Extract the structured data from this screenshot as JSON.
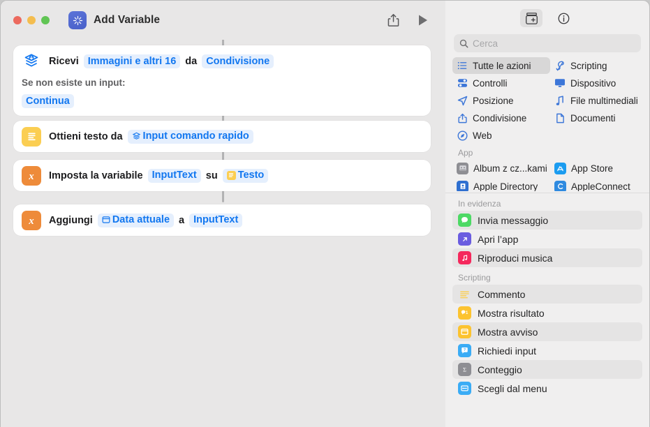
{
  "window": {
    "title": "Add Variable",
    "app_icon": "shortcuts-icon",
    "traffic_lights": [
      "close",
      "minimize",
      "zoom"
    ],
    "share_icon": "share-icon",
    "run_icon": "play-icon"
  },
  "workflow": {
    "actions": [
      {
        "icon": "receive-input-icon",
        "icon_style": "plain-blue",
        "parts": [
          {
            "type": "text",
            "value": "Ricevi"
          },
          {
            "type": "token",
            "value": "Immagini e altri 16"
          },
          {
            "type": "text",
            "value": "da"
          },
          {
            "type": "token",
            "value": "Condivisione"
          }
        ],
        "sub_label": "Se non esiste un input:",
        "sub_token": "Continua"
      },
      {
        "icon": "text-document-icon",
        "icon_style": "yellow",
        "parts": [
          {
            "type": "text",
            "value": "Ottieni testo da"
          },
          {
            "type": "token",
            "value": "Input comando rapido",
            "token_icon": "shortcut-input-icon"
          }
        ]
      },
      {
        "icon": "variable-x-icon",
        "icon_style": "orange",
        "parts": [
          {
            "type": "text",
            "value": "Imposta la variabile"
          },
          {
            "type": "token",
            "value": "InputText"
          },
          {
            "type": "text",
            "value": "su"
          },
          {
            "type": "token",
            "value": "Testo",
            "token_icon": "text-document-icon"
          }
        ]
      },
      {
        "icon": "variable-x-icon",
        "icon_style": "orange",
        "parts": [
          {
            "type": "text",
            "value": "Aggiungi"
          },
          {
            "type": "token",
            "value": "Data attuale",
            "token_icon": "date-icon"
          },
          {
            "type": "text",
            "value": "a"
          },
          {
            "type": "token",
            "value": "InputText"
          }
        ]
      }
    ]
  },
  "library": {
    "toolbar": [
      {
        "name": "action-library-button",
        "icon": "add-action-icon",
        "active": true
      },
      {
        "name": "info-button",
        "icon": "info-circle-icon",
        "active": false
      }
    ],
    "search": {
      "placeholder": "Cerca",
      "value": "",
      "icon": "search-icon"
    },
    "categories": [
      {
        "label": "Tutte le azioni",
        "icon": "list-icon",
        "selected": true
      },
      {
        "label": "Scripting",
        "icon": "scripting-icon",
        "selected": false
      },
      {
        "label": "Controlli",
        "icon": "controls-icon",
        "selected": false
      },
      {
        "label": "Dispositivo",
        "icon": "display-icon",
        "selected": false
      },
      {
        "label": "Posizione",
        "icon": "location-arrow-icon",
        "selected": false
      },
      {
        "label": "File multimediali",
        "icon": "music-note-icon",
        "selected": false
      },
      {
        "label": "Condivisione",
        "icon": "share-icon",
        "selected": false
      },
      {
        "label": "Documenti",
        "icon": "document-icon",
        "selected": false
      },
      {
        "label": "Web",
        "icon": "compass-icon",
        "selected": false
      }
    ],
    "app_section": {
      "title": "App",
      "items": [
        {
          "label": "Album z cz...kami",
          "icon": "photos-album-icon"
        },
        {
          "label": "App Store",
          "icon": "app-store-icon"
        },
        {
          "label": "Apple Directory",
          "icon": "apple-directory-icon"
        },
        {
          "label": "AppleConnect",
          "icon": "appleconnect-icon"
        }
      ]
    },
    "featured_section": {
      "title": "In evidenza",
      "items": [
        {
          "label": "Invia messaggio",
          "icon": "messages-icon",
          "color": "#4cd964"
        },
        {
          "label": "Apri l’app",
          "icon": "open-app-icon",
          "color": "#6a5ce0"
        },
        {
          "label": "Riproduci musica",
          "icon": "music-icon",
          "color": "#f5285c"
        }
      ]
    },
    "scripting_section": {
      "title": "Scripting",
      "items": [
        {
          "label": "Commento",
          "icon": "comment-icon",
          "color": "transparent"
        },
        {
          "label": "Mostra risultato",
          "icon": "show-result-icon",
          "color": "#fcc330"
        },
        {
          "label": "Mostra avviso",
          "icon": "show-alert-icon",
          "color": "#fcc330"
        },
        {
          "label": "Richiedi input",
          "icon": "ask-input-icon",
          "color": "#3bacf5"
        },
        {
          "label": "Conteggio",
          "icon": "count-sigma-icon",
          "color": "#8e8e93"
        },
        {
          "label": "Scegli dal menu",
          "icon": "choose-menu-icon",
          "color": "#3bacf5"
        }
      ]
    }
  },
  "colors": {
    "accent_blue": "#1277f0",
    "token_bg": "#e5effd",
    "canvas": "#e8e7e7",
    "sidebar": "#f0efef",
    "orange": "#ee8b3a",
    "yellow": "#fbce52"
  }
}
